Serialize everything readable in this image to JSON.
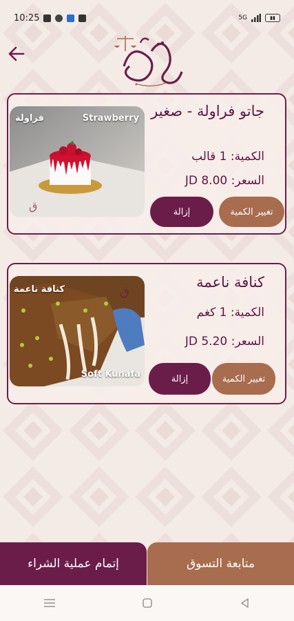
{
  "status_bar": {
    "time": "10:25",
    "signal_text": "5G"
  },
  "header": {
    "back_icon": "arrow-left-icon",
    "logo_text": "القاضي",
    "logo_subtext": "إبراهيم حلويات"
  },
  "cart_items": [
    {
      "title": "جاتو فراولة - صغير",
      "quantity": "الكمية: 1 قالب",
      "price": "السعر: JD 8.00",
      "image_label_en": "Strawberry",
      "image_label_ar": "فراولة",
      "remove_label": "إزالة",
      "change_qty_label": "تغيير الكمية"
    },
    {
      "title": "كنافة ناعمة",
      "quantity": "الكمية: 1 كغم",
      "price": "السعر: JD 5.20",
      "image_label_en": "Soft Kunafa",
      "image_label_ar": "كنافة ناعمة",
      "remove_label": "إزالة",
      "change_qty_label": "تغيير الكمية"
    }
  ],
  "bottom": {
    "checkout_label": "إتمام عملية الشراء",
    "continue_label": "متابعة التسوق"
  },
  "colors": {
    "primary": "#6b1d4a",
    "accent": "#a86c4f",
    "background": "#f4ebe7"
  }
}
